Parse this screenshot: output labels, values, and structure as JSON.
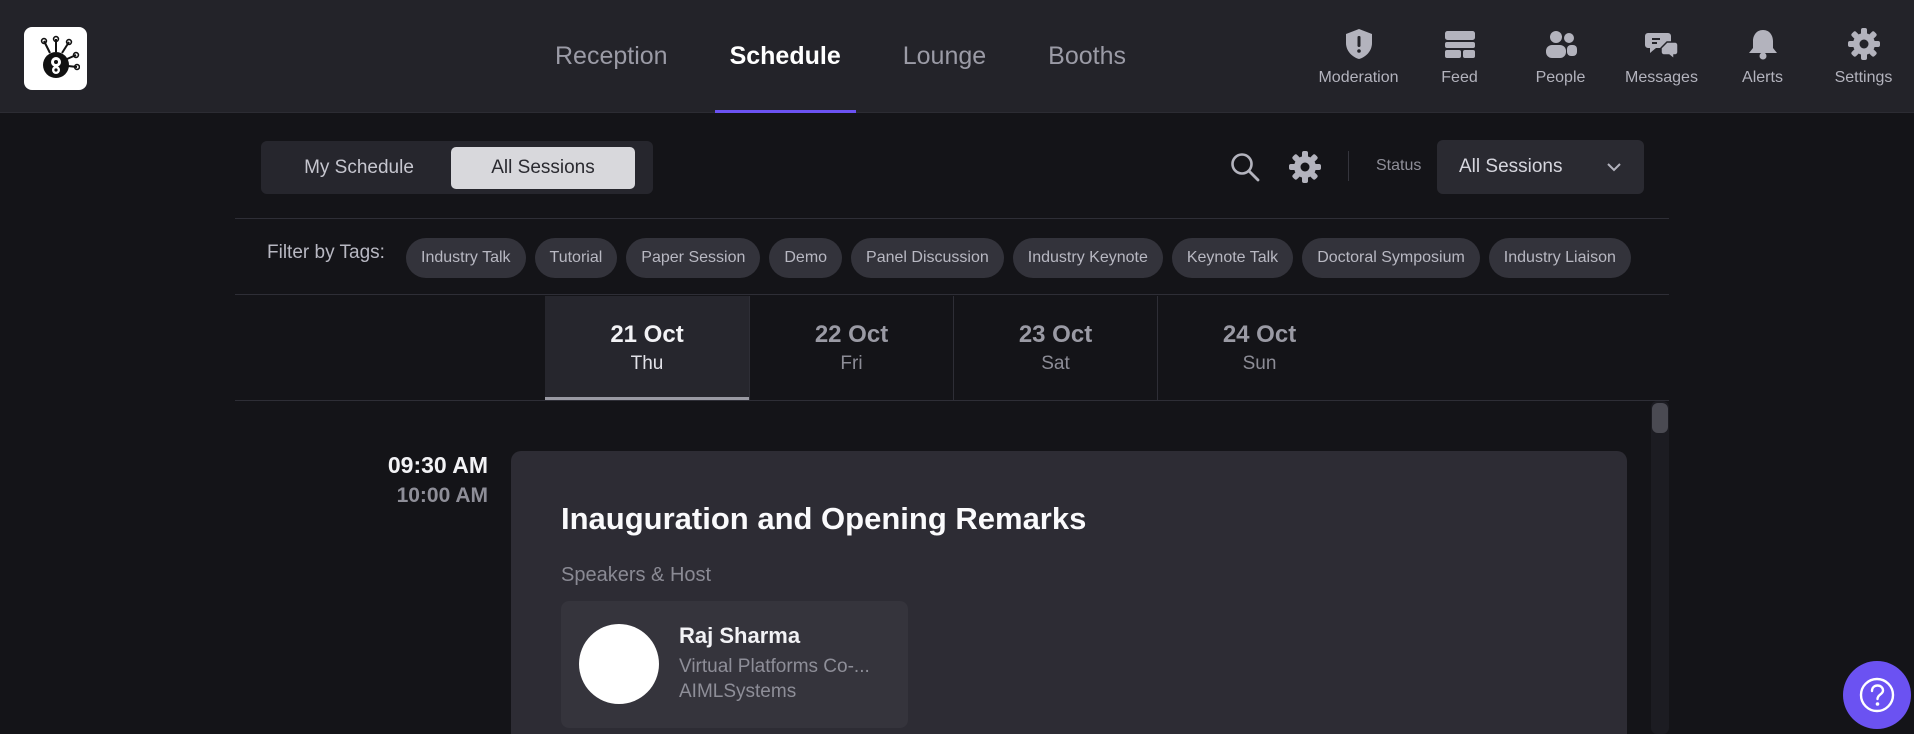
{
  "nav": {
    "tabs": [
      {
        "label": "Reception"
      },
      {
        "label": "Schedule"
      },
      {
        "label": "Lounge"
      },
      {
        "label": "Booths"
      }
    ],
    "active_tab": "Schedule",
    "right": [
      {
        "label": "Moderation",
        "icon": "shield-icon"
      },
      {
        "label": "Feed",
        "icon": "feed-icon"
      },
      {
        "label": "People",
        "icon": "people-icon"
      },
      {
        "label": "Messages",
        "icon": "messages-icon"
      },
      {
        "label": "Alerts",
        "icon": "bell-icon"
      },
      {
        "label": "Settings",
        "icon": "gear-icon"
      }
    ]
  },
  "toolbar": {
    "my_schedule": "My Schedule",
    "all_sessions": "All Sessions",
    "status_label": "Status",
    "status_value": "All Sessions"
  },
  "filters": {
    "label": "Filter by Tags:",
    "tags": [
      "Industry Talk",
      "Tutorial",
      "Paper Session",
      "Demo",
      "Panel Discussion",
      "Industry Keynote",
      "Keynote Talk",
      "Doctoral Symposium",
      "Industry Liaison"
    ]
  },
  "dates": [
    {
      "date": "21 Oct",
      "day": "Thu"
    },
    {
      "date": "22 Oct",
      "day": "Fri"
    },
    {
      "date": "23 Oct",
      "day": "Sat"
    },
    {
      "date": "24 Oct",
      "day": "Sun"
    }
  ],
  "session": {
    "start": "09:30 AM",
    "end": "10:00 AM",
    "title": "Inauguration and Opening Remarks",
    "speakers_label": "Speakers & Host",
    "speaker": {
      "name": "Raj Sharma",
      "role": "Virtual Platforms Co-...",
      "org": "AIMLSystems"
    }
  },
  "colors": {
    "accent": "#6b52f2",
    "background": "#141418",
    "topbar": "#232329",
    "card": "#2d2c34"
  }
}
